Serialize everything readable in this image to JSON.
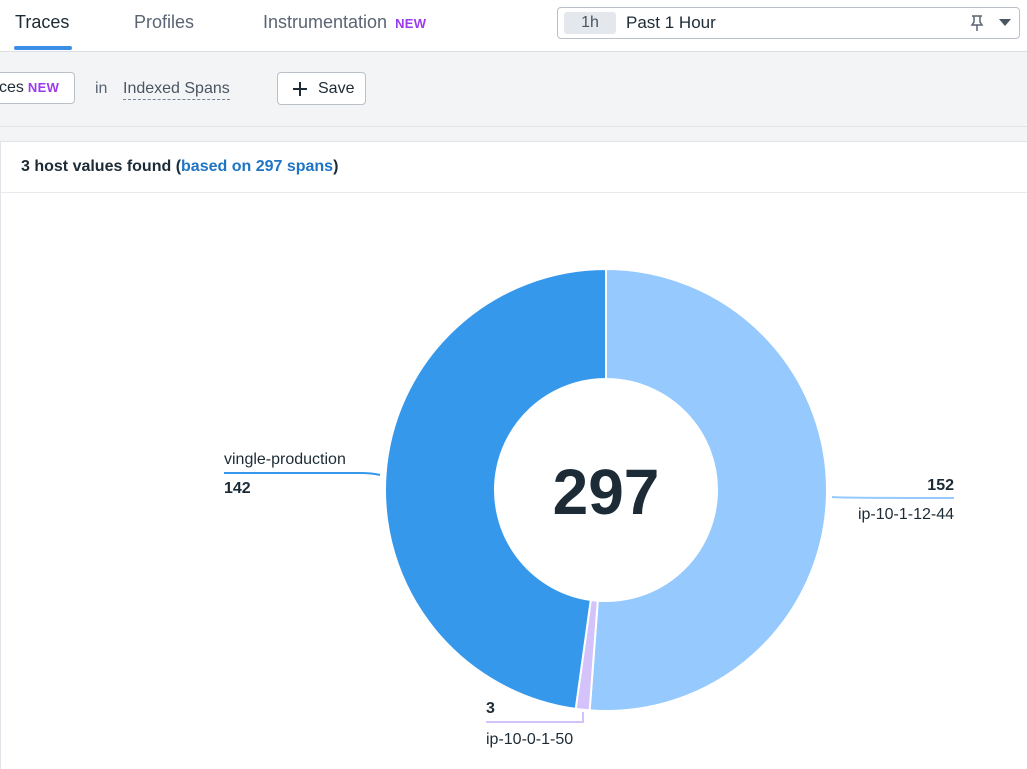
{
  "nav": {
    "tabs": [
      {
        "label": "Traces",
        "active": true
      },
      {
        "label": "Profiles",
        "active": false
      },
      {
        "label": "Instrumentation",
        "active": false,
        "badge": "NEW"
      }
    ],
    "time_picker": {
      "chip": "1h",
      "label": "Past 1 Hour"
    }
  },
  "toolbar": {
    "traces_label": "ces",
    "traces_badge": "NEW",
    "in_label": "in",
    "index_select": "Indexed Spans",
    "save_label": "Save"
  },
  "panel": {
    "title_prefix": "3 host values found (",
    "title_link": "based on 297 spans",
    "title_suffix": ")"
  },
  "colors": {
    "accent": "#3a8ee6",
    "badge": "#9b3bf0",
    "link": "#1f74c4"
  },
  "chart_data": {
    "type": "pie",
    "total": 297,
    "slices": [
      {
        "name": "ip-10-1-12-44",
        "value": 152,
        "color": "#96c9fd"
      },
      {
        "name": "ip-10-0-1-50",
        "value": 3,
        "color": "#d4c3fb"
      },
      {
        "name": "vingle-production",
        "value": 142,
        "color": "#3698eb"
      }
    ]
  }
}
